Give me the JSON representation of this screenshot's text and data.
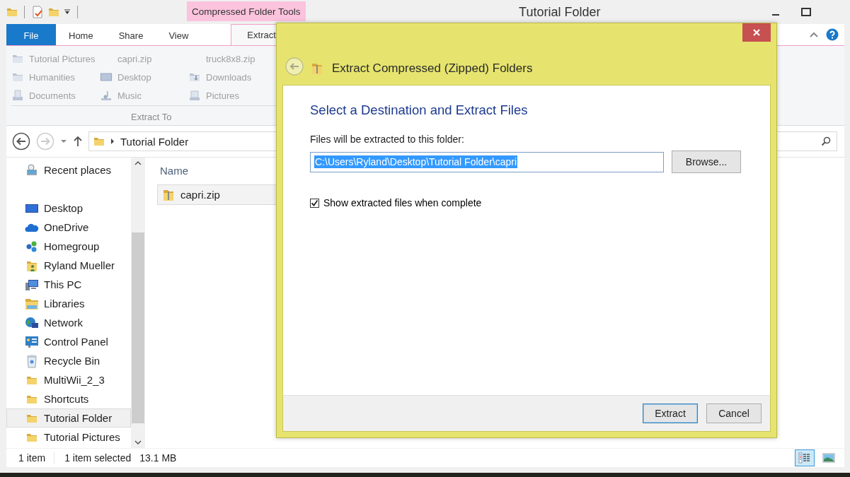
{
  "window": {
    "title": "Tutorial Folder",
    "contextual_tab": "Compressed Folder Tools"
  },
  "ribbon": {
    "tabs": [
      {
        "label": "File",
        "kind": "file",
        "selected": false
      },
      {
        "label": "Home",
        "kind": "normal",
        "selected": false
      },
      {
        "label": "Share",
        "kind": "normal",
        "selected": false
      },
      {
        "label": "View",
        "kind": "normal",
        "selected": false
      },
      {
        "label": "Extract",
        "kind": "contextual",
        "selected": true
      }
    ],
    "group": {
      "label": "Extract To",
      "items": [
        {
          "label": "Tutorial Pictures",
          "kind": "folder",
          "disabled": true
        },
        {
          "label": "capri.zip",
          "kind": "none",
          "disabled": true
        },
        {
          "label": "truck8x8.zip",
          "kind": "none",
          "disabled": true
        },
        {
          "label": "Humanities",
          "kind": "folder",
          "disabled": true
        },
        {
          "label": "Desktop",
          "kind": "desktop",
          "disabled": true
        },
        {
          "label": "Downloads",
          "kind": "downloads",
          "disabled": true
        },
        {
          "label": "Documents",
          "kind": "documents",
          "disabled": true
        },
        {
          "label": "Music",
          "kind": "music",
          "disabled": true
        },
        {
          "label": "Pictures",
          "kind": "pictures",
          "disabled": true
        }
      ]
    }
  },
  "address": {
    "path": "Tutorial Folder"
  },
  "nav": {
    "groups": [
      {
        "items": [
          {
            "label": "Recent places",
            "kind": "recent",
            "selected": false
          }
        ]
      },
      {
        "items": [
          {
            "label": "Desktop",
            "kind": "desktop",
            "selected": false
          },
          {
            "label": "OneDrive",
            "kind": "cloud",
            "selected": false
          },
          {
            "label": "Homegroup",
            "kind": "homegroup",
            "selected": false
          },
          {
            "label": "Ryland Mueller",
            "kind": "user",
            "selected": false
          },
          {
            "label": "This PC",
            "kind": "pc",
            "selected": false
          },
          {
            "label": "Libraries",
            "kind": "libraries",
            "selected": false
          },
          {
            "label": "Network",
            "kind": "network",
            "selected": false
          },
          {
            "label": "Control Panel",
            "kind": "control",
            "selected": false
          },
          {
            "label": "Recycle Bin",
            "kind": "recycle",
            "selected": false
          },
          {
            "label": "MultiWii_2_3",
            "kind": "folder",
            "selected": false
          },
          {
            "label": "Shortcuts",
            "kind": "folder",
            "selected": false
          },
          {
            "label": "Tutorial Folder",
            "kind": "folder",
            "selected": true
          },
          {
            "label": "Tutorial Pictures",
            "kind": "folder",
            "selected": false
          }
        ]
      }
    ]
  },
  "files": {
    "columns": [
      "Name"
    ],
    "rows": [
      {
        "name": "capri.zip",
        "kind": "zip",
        "selected": true
      }
    ]
  },
  "status_bar": {
    "items": [
      "1 item",
      "1 item selected",
      "13.1 MB"
    ],
    "views": [
      {
        "kind": "details",
        "selected": true
      },
      {
        "kind": "preview",
        "selected": false
      }
    ]
  },
  "dialog": {
    "title": "Extract Compressed (Zipped) Folders",
    "heading": "Select a Destination and Extract Files",
    "label": "Files will be extracted to this folder:",
    "path": "C:\\Users\\Ryland\\Desktop\\Tutorial Folder\\capri",
    "browse": "Browse...",
    "checkbox": {
      "label": "Show extracted files when complete",
      "checked": true
    },
    "buttons": [
      {
        "label": "Extract",
        "default": true
      },
      {
        "label": "Cancel",
        "default": false
      }
    ]
  }
}
